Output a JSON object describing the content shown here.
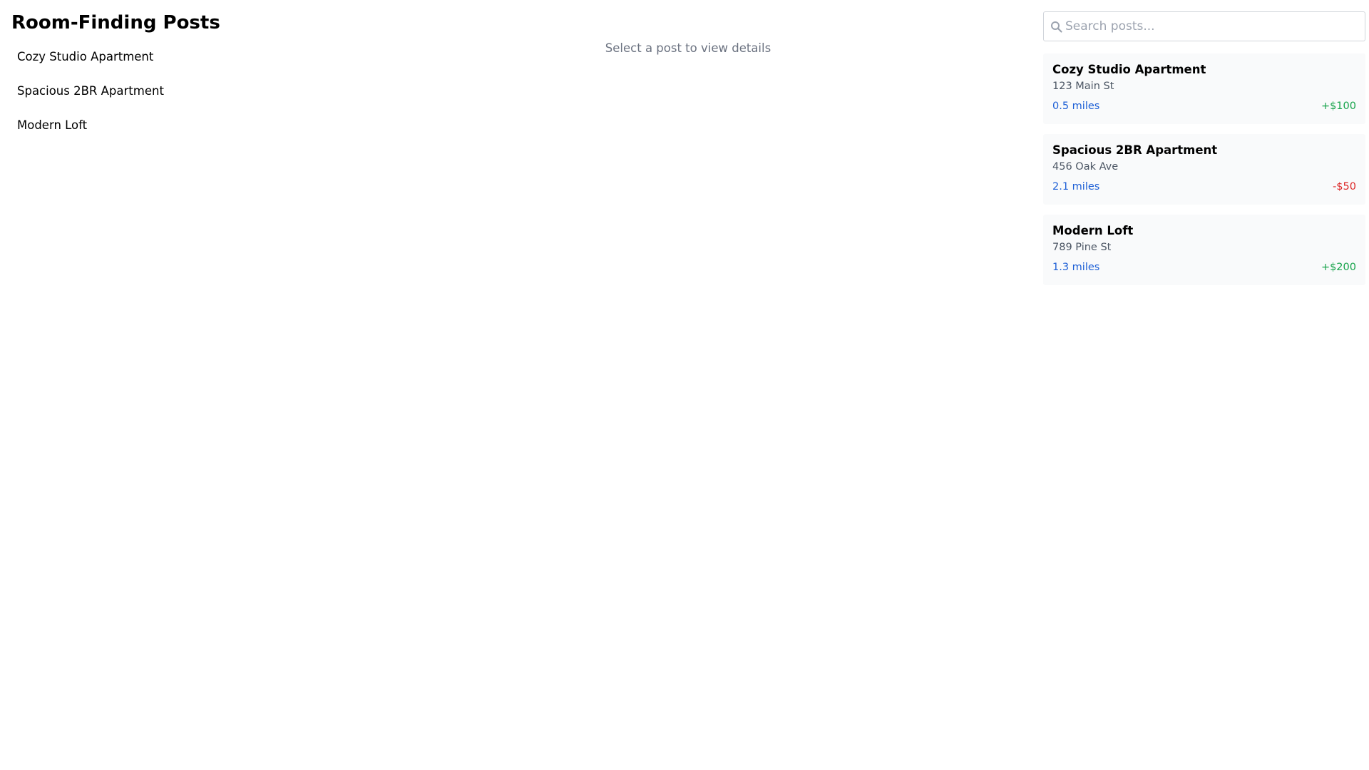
{
  "header": {
    "title": "Room-Finding Posts"
  },
  "sidebar": {
    "items": [
      {
        "label": "Cozy Studio Apartment"
      },
      {
        "label": "Spacious 2BR Apartment"
      },
      {
        "label": "Modern Loft"
      }
    ]
  },
  "detail": {
    "empty_message": "Select a post to view details"
  },
  "search": {
    "icon": "search-icon",
    "placeholder": "Search posts...",
    "value": ""
  },
  "posts": [
    {
      "title": "Cozy Studio Apartment",
      "address": "123 Main St",
      "distance": "0.5 miles",
      "price_diff": "+$100"
    },
    {
      "title": "Spacious 2BR Apartment",
      "address": "456 Oak Ave",
      "distance": "2.1 miles",
      "price_diff": "-$50"
    },
    {
      "title": "Modern Loft",
      "address": "789 Pine St",
      "distance": "1.3 miles",
      "price_diff": "+$200"
    }
  ],
  "colors": {
    "distance": "#1d5fd6",
    "price_positive": "#16a34a",
    "price_negative": "#dc2626",
    "muted_text": "#6b7280",
    "card_background": "#f9fafb"
  }
}
